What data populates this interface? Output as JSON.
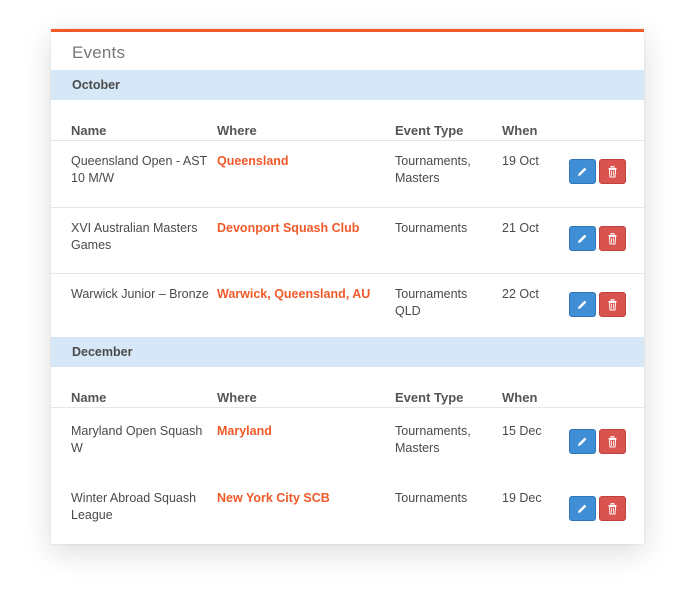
{
  "panel": {
    "title": "Events"
  },
  "columns": {
    "name": "Name",
    "where": "Where",
    "type": "Event Type",
    "when": "When"
  },
  "months": [
    {
      "label": "October",
      "events": [
        {
          "name": "Queensland Open - AST 10 M/W",
          "where": "Queensland",
          "type": "Tournaments, Masters",
          "when": "19 Oct"
        },
        {
          "name": "XVI Australian Masters Games",
          "where": "Devonport Squash Club",
          "type": "Tournaments",
          "when": "21 Oct"
        },
        {
          "name": "Warwick Junior – Bronze",
          "where": "Warwick, Queensland, AU",
          "type": "Tournaments QLD",
          "when": "22 Oct"
        }
      ]
    },
    {
      "label": "December",
      "events": [
        {
          "name": "Maryland Open Squash W",
          "where": "Maryland",
          "type": "Tournaments, Masters",
          "when": "15 Dec"
        },
        {
          "name": "Winter Abroad Squash League",
          "where": "New York City SCB",
          "type": "Tournaments",
          "when": "19 Dec"
        }
      ]
    }
  ],
  "icons": {
    "edit": "pencil-icon",
    "delete": "trash-icon"
  },
  "colors": {
    "accent": "#f05a28",
    "month_bar": "#d6e8f7",
    "edit_button": "#3f8ed6",
    "delete_button": "#d9534f"
  }
}
